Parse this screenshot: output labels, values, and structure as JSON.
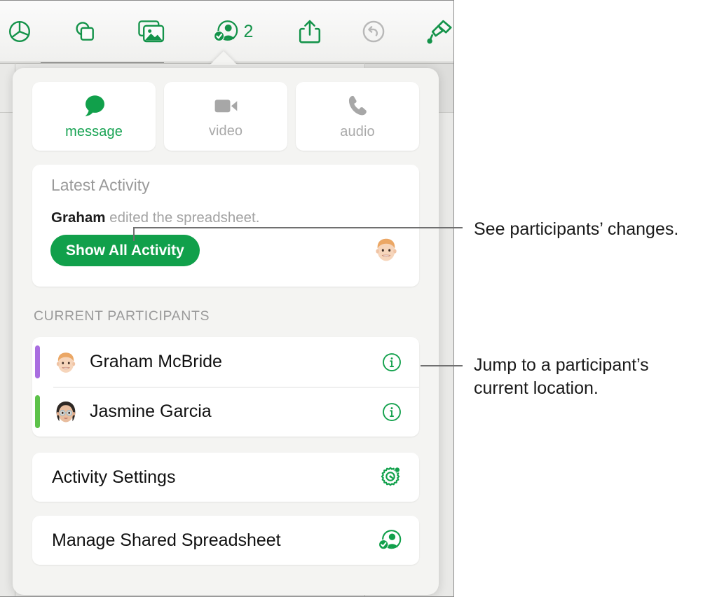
{
  "accent_green": "#11a04b",
  "toolbar": {
    "items": [
      {
        "name": "chart-icon",
        "label": "Chart",
        "state": "enabled"
      },
      {
        "name": "shape-icon",
        "label": "Shape",
        "state": "enabled"
      },
      {
        "name": "media-icon",
        "label": "Media",
        "state": "enabled"
      },
      {
        "name": "collaborate-icon",
        "label": "Collaborate",
        "state": "selected"
      },
      {
        "name": "share-icon",
        "label": "Share",
        "state": "enabled"
      },
      {
        "name": "undo-icon",
        "label": "Undo",
        "state": "disabled"
      },
      {
        "name": "format-brush-icon",
        "label": "Format",
        "state": "enabled"
      }
    ],
    "participant_count": "2"
  },
  "popover": {
    "modes": [
      {
        "icon": "message-bubble-icon",
        "label": "message",
        "active": true
      },
      {
        "icon": "video-camera-icon",
        "label": "video",
        "active": false
      },
      {
        "icon": "phone-handset-icon",
        "label": "audio",
        "active": false
      }
    ],
    "activity": {
      "title": "Latest Activity",
      "actor": "Graham",
      "detail": " edited the spreadsheet.",
      "show_all_label": "Show All Activity",
      "avatar_name": "graham-memoji-avatar"
    },
    "participants_header": "CURRENT PARTICIPANTS",
    "participants": [
      {
        "name": "Graham McBride",
        "color": "#a96ee0",
        "avatar": "graham-memoji-avatar",
        "info_icon": "info-circle-icon"
      },
      {
        "name": "Jasmine Garcia",
        "color": "#5dc24a",
        "avatar": "jasmine-memoji-avatar",
        "info_icon": "info-circle-icon"
      }
    ],
    "actions": [
      {
        "label": "Activity Settings",
        "icon": "activity-settings-gear-icon"
      },
      {
        "label": "Manage Shared Spreadsheet",
        "icon": "manage-share-person-icon"
      }
    ]
  },
  "callouts": [
    {
      "name": "callout-see-changes",
      "text": "See participants’ changes."
    },
    {
      "name": "callout-jump-to-location",
      "text": "Jump to a participant’s\ncurrent location."
    }
  ]
}
